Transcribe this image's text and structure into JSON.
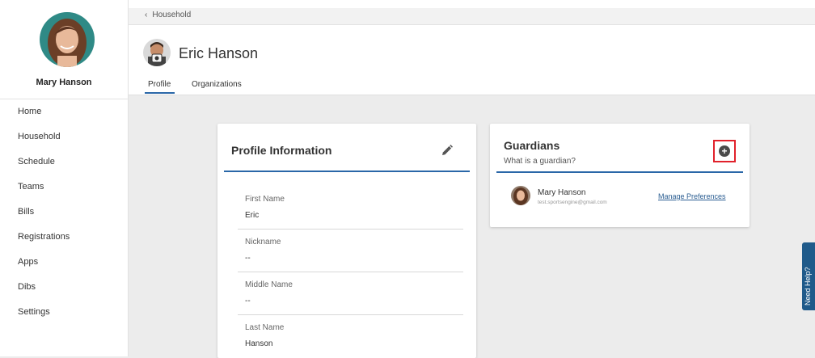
{
  "sidebar": {
    "user_name": "Mary Hanson",
    "items": [
      {
        "label": "Home"
      },
      {
        "label": "Household"
      },
      {
        "label": "Schedule"
      },
      {
        "label": "Teams"
      },
      {
        "label": "Bills"
      },
      {
        "label": "Registrations"
      },
      {
        "label": "Apps"
      },
      {
        "label": "Dibs"
      },
      {
        "label": "Settings"
      }
    ]
  },
  "header": {
    "breadcrumb": "Household",
    "person_name": "Eric Hanson",
    "tabs": [
      {
        "label": "Profile",
        "active": true
      },
      {
        "label": "Organizations",
        "active": false
      }
    ]
  },
  "profile_card": {
    "title": "Profile Information",
    "fields": [
      {
        "label": "First Name",
        "value": "Eric"
      },
      {
        "label": "Nickname",
        "value": "--"
      },
      {
        "label": "Middle Name",
        "value": "--"
      },
      {
        "label": "Last Name",
        "value": "Hanson"
      }
    ]
  },
  "guardians_card": {
    "title": "Guardians",
    "help_link": "What is a guardian?",
    "add_icon": "plus-circle-icon",
    "guardian": {
      "name": "Mary Hanson",
      "email": "test.sportsengine@gmail.com",
      "action": "Manage Preferences"
    }
  },
  "help_tab": {
    "label": "Need Help?"
  },
  "colors": {
    "accent": "#2a67a8",
    "highlight": "#e1212b",
    "background": "#ececec",
    "help_tab": "#1f5a8a"
  }
}
